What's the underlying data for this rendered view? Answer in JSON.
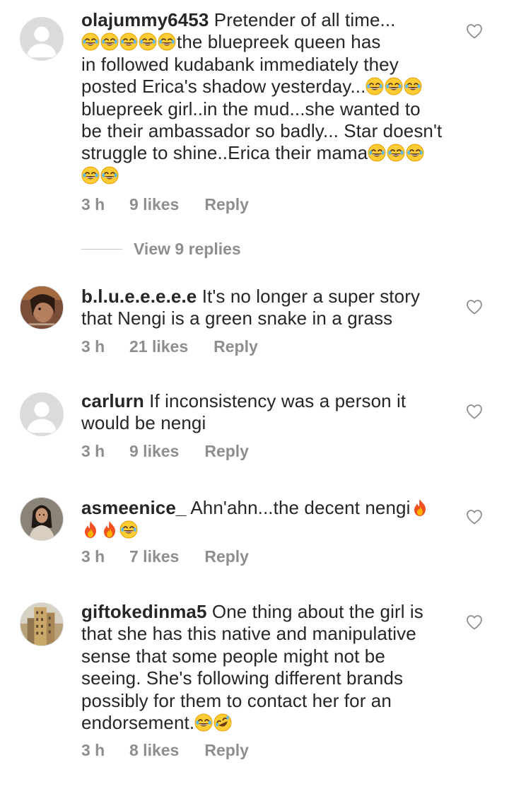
{
  "comments": [
    {
      "username": "olajummy6453",
      "lines": [
        "Pretender of all time...",
        "the bluepreek queen has",
        "in followed kudabank immediately they",
        "posted Erica's shadow yesterday...",
        "bluepreek girl..in the mud...she wanted to",
        "be their ambassador so badly... Star doesn't",
        "struggle to shine..Erica their mama"
      ],
      "time": "3 h",
      "likes": "9 likes",
      "reply": "Reply",
      "emoji": "face-with-tears-of-joy"
    },
    {
      "username": "b.l.u.e.e.e.e.e",
      "lines": [
        "It's no longer a super story",
        "that Nengi is a green snake in a grass"
      ],
      "time": "3 h",
      "likes": "21 likes",
      "reply": "Reply"
    },
    {
      "username": "carlurn",
      "lines": [
        "If inconsistency was a person it",
        "would be nengi"
      ],
      "time": "3 h",
      "likes": "9 likes",
      "reply": "Reply"
    },
    {
      "username": "asmeenice_",
      "lines": [
        "Ahn'ahn...the decent nengi"
      ],
      "time": "3 h",
      "likes": "7 likes",
      "reply": "Reply",
      "emoji": "fire"
    },
    {
      "username": "giftokedinma5",
      "lines": [
        "One thing about the girl is",
        "that she has this native and manipulative",
        "sense that some people might not be",
        "seeing. She's following different brands",
        "possibly for them to contact her for an",
        "endorsement."
      ],
      "time": "3 h",
      "likes": "8 likes",
      "reply": "Reply",
      "emoji": "rolling-on-the-floor-laughing"
    }
  ],
  "view_replies": "View 9 replies",
  "colors": {
    "text": "#262626",
    "meta": "#8e8e8e",
    "emoji_yellow": "#ffcc33"
  }
}
